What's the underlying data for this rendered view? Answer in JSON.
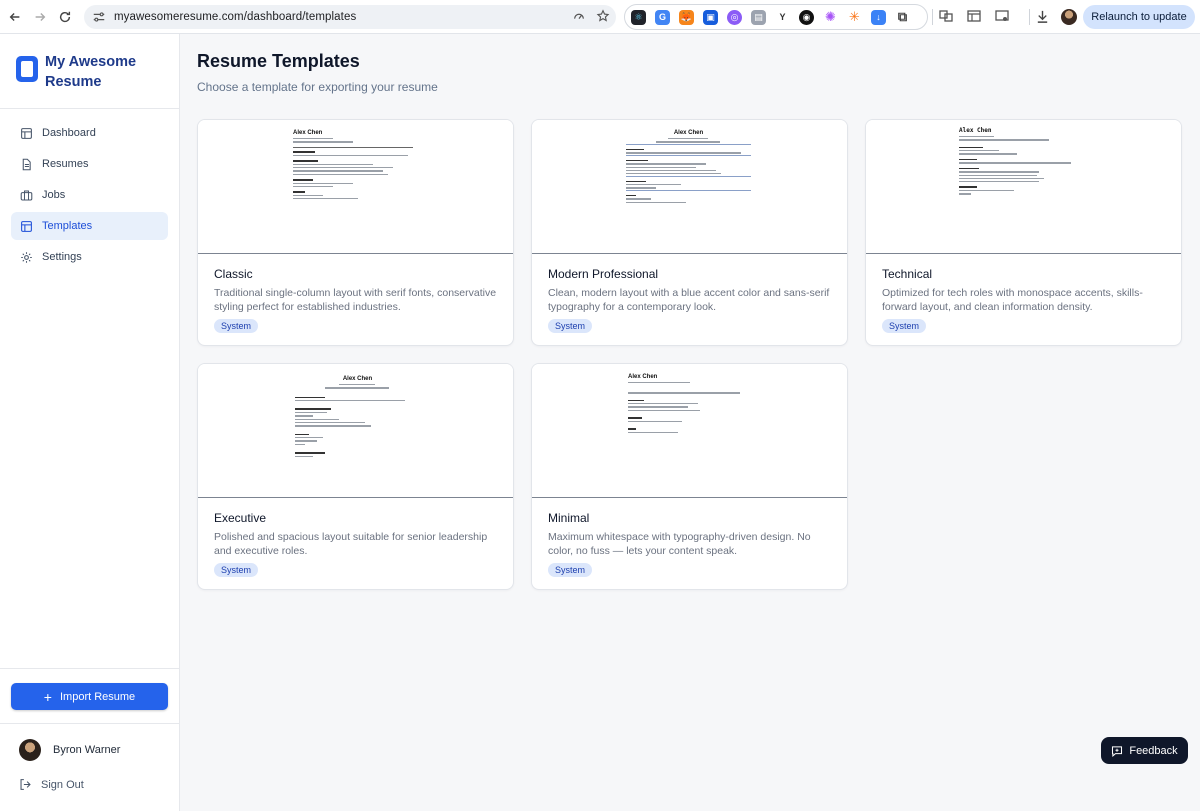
{
  "browser": {
    "url": "myawesomeresume.com/dashboard/templates",
    "relaunch_label": "Relaunch to update"
  },
  "sidebar": {
    "brand": "My Awesome Resume",
    "items": [
      {
        "label": "Dashboard",
        "icon": "layout-icon",
        "active": false
      },
      {
        "label": "Resumes",
        "icon": "document-icon",
        "active": false
      },
      {
        "label": "Jobs",
        "icon": "briefcase-icon",
        "active": false
      },
      {
        "label": "Templates",
        "icon": "layout-icon",
        "active": true
      },
      {
        "label": "Settings",
        "icon": "gear-icon",
        "active": false
      }
    ],
    "import_label": "Import Resume",
    "user_name": "Byron Warner",
    "signout_label": "Sign Out"
  },
  "main": {
    "title": "Resume Templates",
    "subtitle": "Choose a template for exporting your resume",
    "templates": [
      {
        "name": "Classic",
        "description": "Traditional single-column layout with serif fonts, conservative styling perfect for established industries.",
        "badge": "System",
        "preview_name": "Alex Chen"
      },
      {
        "name": "Modern Professional",
        "description": "Clean, modern layout with a blue accent color and sans-serif typography for a contemporary look.",
        "badge": "System",
        "preview_name": "Alex Chen"
      },
      {
        "name": "Technical",
        "description": "Optimized for tech roles with monospace accents, skills-forward layout, and clean information density.",
        "badge": "System",
        "preview_name": "Alex Chen"
      },
      {
        "name": "Executive",
        "description": "Polished and spacious layout suitable for senior leadership and executive roles.",
        "badge": "System",
        "preview_name": "Alex Chen"
      },
      {
        "name": "Minimal",
        "description": "Maximum whitespace with typography-driven design. No color, no fuss — lets your content speak.",
        "badge": "System",
        "preview_name": "Alex Chen"
      }
    ]
  },
  "feedback_label": "Feedback",
  "colors": {
    "accent": "#2563eb",
    "brand_text": "#1e3a8a",
    "active_bg": "#e8f0fb",
    "badge_bg": "#dbe6fb"
  }
}
